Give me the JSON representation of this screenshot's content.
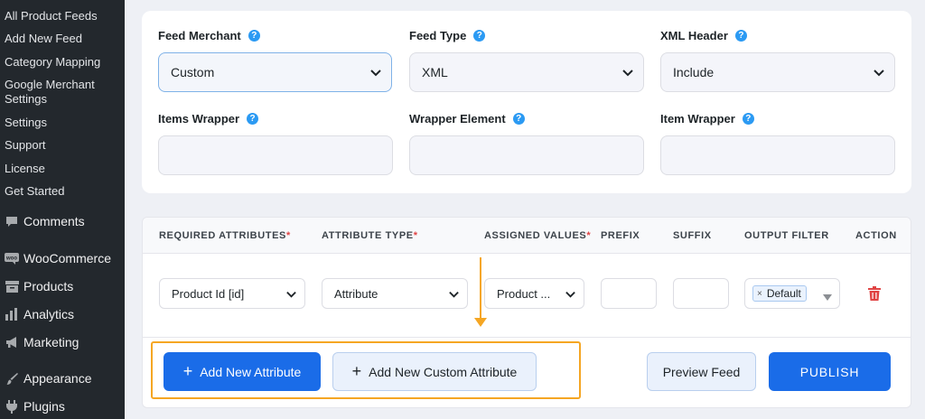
{
  "sidebar": {
    "sub_items": [
      "All Product Feeds",
      "Add New Feed",
      "Category Mapping",
      "Google Merchant Settings",
      "Settings",
      "Support",
      "License",
      "Get Started"
    ],
    "google_merchant_line1": "Google Merchant",
    "google_merchant_line2": "Settings",
    "main_items": [
      {
        "label": "Comments",
        "icon": "comment-icon"
      },
      {
        "label": "WooCommerce",
        "icon": "woo-icon"
      },
      {
        "label": "Products",
        "icon": "archive-icon"
      },
      {
        "label": "Analytics",
        "icon": "bar-chart-icon"
      },
      {
        "label": "Marketing",
        "icon": "megaphone-icon"
      },
      {
        "label": "Appearance",
        "icon": "paintbrush-icon"
      },
      {
        "label": "Plugins",
        "icon": "plug-icon"
      }
    ]
  },
  "form": {
    "feed_merchant": {
      "label": "Feed Merchant",
      "value": "Custom"
    },
    "feed_type": {
      "label": "Feed Type",
      "value": "XML"
    },
    "xml_header": {
      "label": "XML Header",
      "value": "Include"
    },
    "items_wrapper": {
      "label": "Items Wrapper",
      "value": ""
    },
    "wrapper_element": {
      "label": "Wrapper Element",
      "value": ""
    },
    "item_wrapper": {
      "label": "Item Wrapper",
      "value": ""
    },
    "help_glyph": "?"
  },
  "table": {
    "headers": {
      "required_attributes": "REQUIRED ATTRIBUTES",
      "attribute_type": "ATTRIBUTE TYPE",
      "assigned_values": "ASSIGNED VALUES",
      "prefix": "PREFIX",
      "suffix": "SUFFIX",
      "output_filter": "OUTPUT FILTER",
      "action": "ACTION"
    },
    "required_mark": "*",
    "row": {
      "attribute": "Product Id [id]",
      "type": "Attribute",
      "assigned": "Product ...",
      "prefix": "",
      "suffix": "",
      "filter_tag": "Default",
      "filter_tag_remove": "×"
    }
  },
  "buttons": {
    "add_attribute": "Add New Attribute",
    "add_custom_attribute": "Add New Custom Attribute",
    "preview": "Preview Feed",
    "publish": "PUBLISH",
    "plus": "+"
  },
  "colors": {
    "sidebar_bg": "#23282d",
    "primary": "#1a6ce8",
    "help": "#2b9af3",
    "highlight": "#f5a623",
    "delete": "#e04444"
  }
}
